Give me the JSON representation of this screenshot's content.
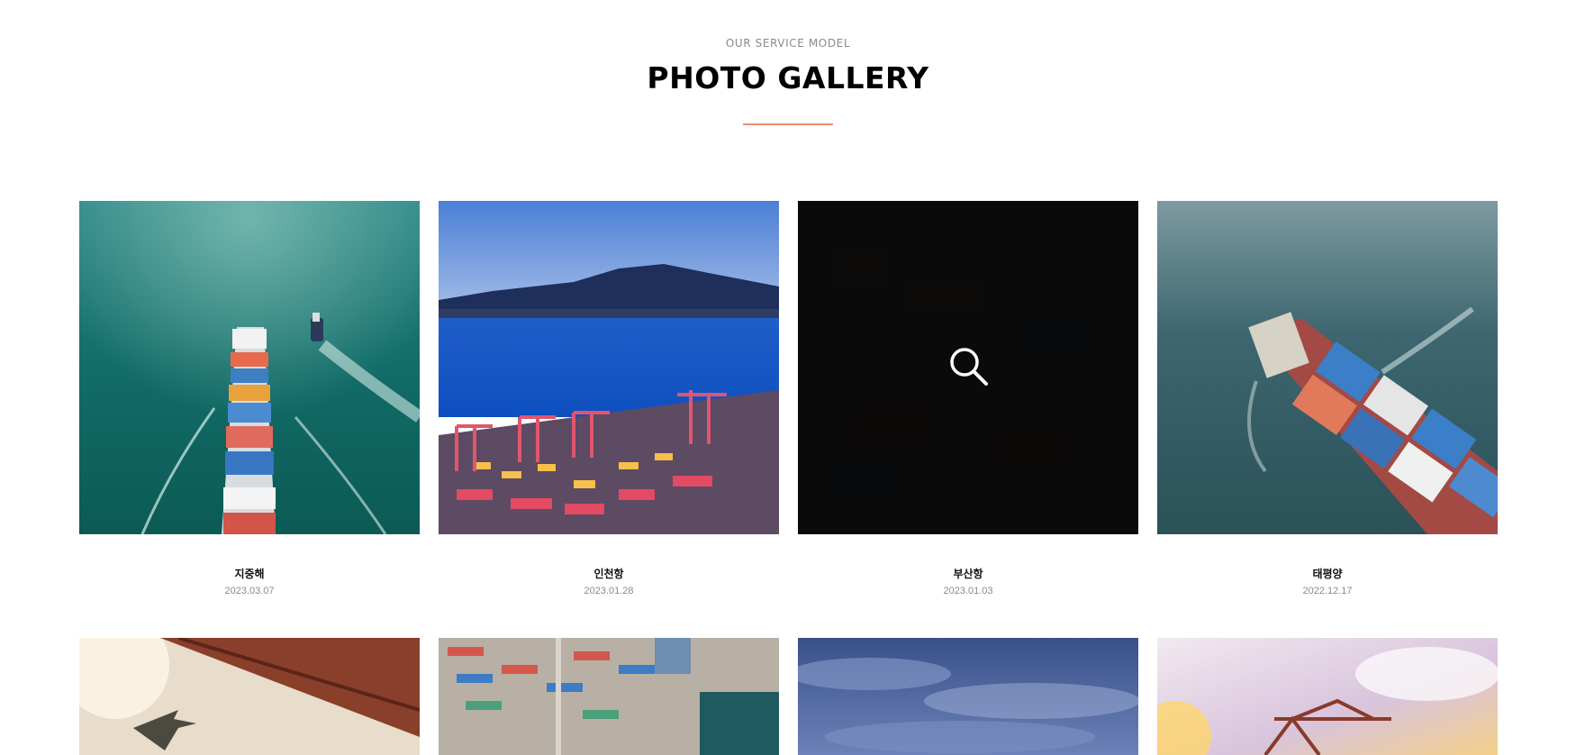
{
  "section": {
    "eyebrow": "OUR SERVICE MODEL",
    "title": "PHOTO GALLERY",
    "accent_color": "#f0896d"
  },
  "gallery": {
    "items": [
      {
        "title": "지중해",
        "date": "2023.03.07",
        "scene": "aerial container ship on green sea with tug boat"
      },
      {
        "title": "인천항",
        "date": "2023.01.28",
        "scene": "port cranes at dusk with city and mountain"
      },
      {
        "title": "부산항",
        "date": "2023.01.03",
        "scene": "container terminal with cranes (hovered)"
      },
      {
        "title": "태평양",
        "date": "2022.12.17",
        "scene": "aerial container ship on dark sea"
      }
    ],
    "row2": [
      {
        "scene": "airplane and shipping containers against sky"
      },
      {
        "scene": "aerial container yard with cranes"
      },
      {
        "scene": "dramatic blue cloudy sky"
      },
      {
        "scene": "port crane against sunset clouds"
      }
    ],
    "hover_icon": "search-icon"
  }
}
